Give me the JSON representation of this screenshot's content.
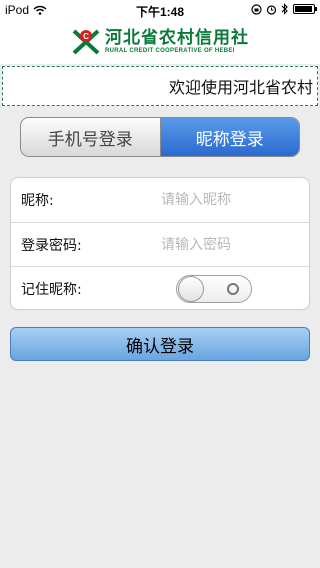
{
  "status_bar": {
    "carrier": "iPod",
    "time": "下午1:48"
  },
  "header": {
    "logo_cn": "河北省农村信用社",
    "logo_en": "RURAL CREDIT COOPERATIVE OF HEBEI"
  },
  "marquee": {
    "text": "欢迎使用河北省农村"
  },
  "tabs": [
    {
      "label": "手机号登录",
      "active": false
    },
    {
      "label": "昵称登录",
      "active": true
    }
  ],
  "form": {
    "nickname_label": "昵称:",
    "nickname_placeholder": "请输入昵称",
    "password_label": "登录密码:",
    "password_placeholder": "请输入密码",
    "remember_label": "记住昵称:",
    "remember_on": false
  },
  "confirm_label": "确认登录",
  "colors": {
    "brand_green": "#0a7a3a",
    "accent_blue": "#2a6ad0"
  },
  "icons": [
    "wifi-icon",
    "lock-rotation-icon",
    "alarm-icon",
    "bluetooth-icon",
    "battery-icon",
    "logo-icon"
  ]
}
